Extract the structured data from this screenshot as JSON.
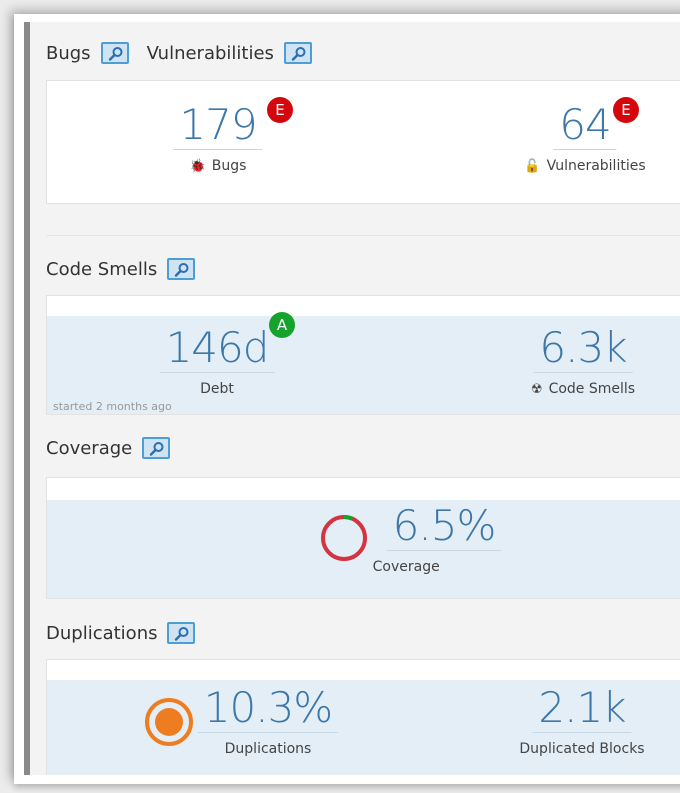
{
  "reliability": {
    "bugs_title": "Bugs",
    "vulnerabilities_title": "Vulnerabilities",
    "bugs": {
      "value": "179",
      "rating": "E",
      "label": "Bugs",
      "icon": "bug-icon"
    },
    "vulnerabilities": {
      "value": "64",
      "rating": "E",
      "label": "Vulnerabilities",
      "icon": "lock-icon"
    }
  },
  "code_smells": {
    "title": "Code Smells",
    "debt": {
      "value": "146d",
      "rating": "A",
      "label": "Debt"
    },
    "smells": {
      "value": "6.3k",
      "label": "Code Smells",
      "icon": "radiation-icon"
    },
    "since": "started 2 months ago"
  },
  "coverage": {
    "title": "Coverage",
    "value": "6.5%",
    "label": "Coverage",
    "percent": 6.5
  },
  "duplications": {
    "title": "Duplications",
    "value": "10.3%",
    "label": "Duplications",
    "blocks_value": "2.1k",
    "blocks_label": "Duplicated Blocks"
  },
  "colors": {
    "accent": "#3c77a8",
    "rating_e": "#d4080c",
    "rating_a": "#15a32c",
    "coverage_covered": "#15a32c",
    "coverage_uncovered": "#d4333f",
    "duplication": "#ed7d20",
    "band": "#e3eef7"
  }
}
